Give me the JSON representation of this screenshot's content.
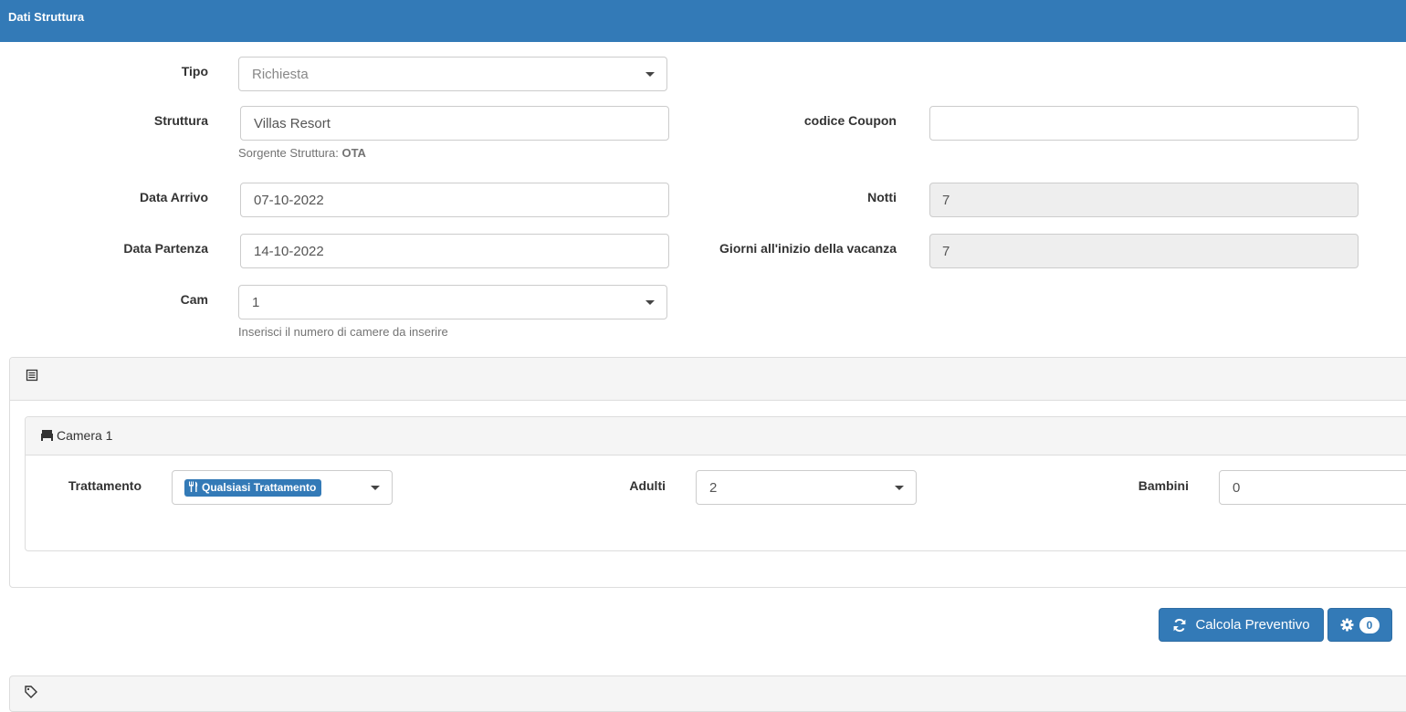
{
  "header": {
    "title": "Dati Struttura"
  },
  "form": {
    "tipo": {
      "label": "Tipo",
      "value": "Richiesta"
    },
    "struttura": {
      "label": "Struttura",
      "value": "Villas Resort",
      "help_prefix": "Sorgente Struttura: ",
      "help_value": "OTA"
    },
    "coupon": {
      "label": "codice Coupon",
      "value": ""
    },
    "arrivo": {
      "label": "Data Arrivo",
      "value": "07-10-2022"
    },
    "notti": {
      "label": "Notti",
      "value": "7"
    },
    "partenza": {
      "label": "Data Partenza",
      "value": "14-10-2022"
    },
    "giorni": {
      "label": "Giorni all'inizio della vacanza",
      "value": "7"
    },
    "cam": {
      "label": "Cam",
      "value": "1",
      "help": "Inserisci il numero di camere da inserire"
    }
  },
  "rooms_panel": {
    "icon": "list-icon"
  },
  "camera": {
    "title": "Camera 1",
    "icon": "bed-icon",
    "trattamento": {
      "label": "Trattamento",
      "value": "Qualsiasi Trattamento",
      "icon": "cutlery-icon"
    },
    "adulti": {
      "label": "Adulti",
      "value": "2"
    },
    "bambini": {
      "label": "Bambini",
      "value": "0"
    }
  },
  "actions": {
    "calcola_label": "Calcola Preventivo",
    "calcola_icon": "refresh-icon",
    "settings_icon": "gear-icon",
    "settings_count": "0"
  },
  "colors": {
    "primary": "#337ab7",
    "panel_bg": "#f5f5f5",
    "readonly_bg": "#eeeeee"
  }
}
